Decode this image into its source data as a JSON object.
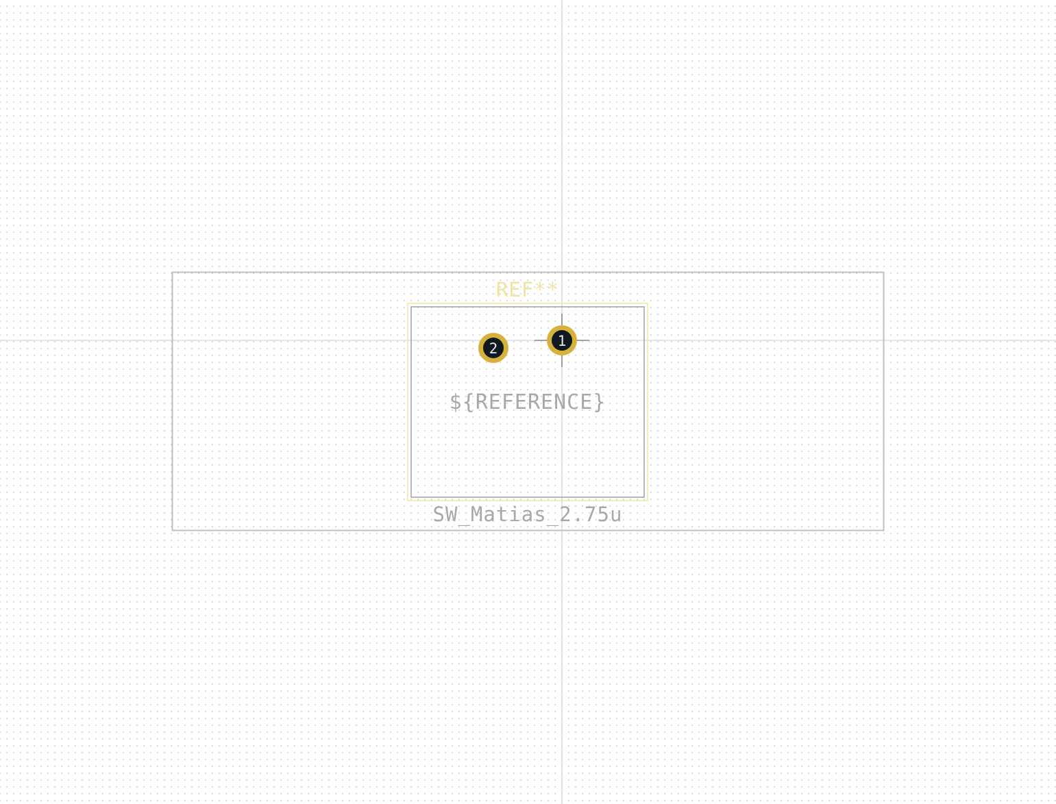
{
  "footprint": {
    "reference_field": "REF**",
    "value_field": "SW_Matias_2.75u",
    "user_text": "${REFERENCE}",
    "pads": [
      {
        "number": "1",
        "shape": "circle"
      },
      {
        "number": "2",
        "shape": "circle"
      }
    ]
  },
  "colors": {
    "background": "#ffffff",
    "grid_dot": "#b8b8b8",
    "axis_line": "#c8c8c8",
    "courtyard": "#c0c0c0",
    "fab_outline": "#a0a0a0",
    "silkscreen_reference": "#efe5a0",
    "keepout_outline": "#f0e6a8",
    "user_text": "#a8a8a8",
    "value_text": "#a8a8a8",
    "pad_copper": "#d7b23a",
    "pad_hole": "#101820",
    "pad_number": "#e8e8e8"
  }
}
